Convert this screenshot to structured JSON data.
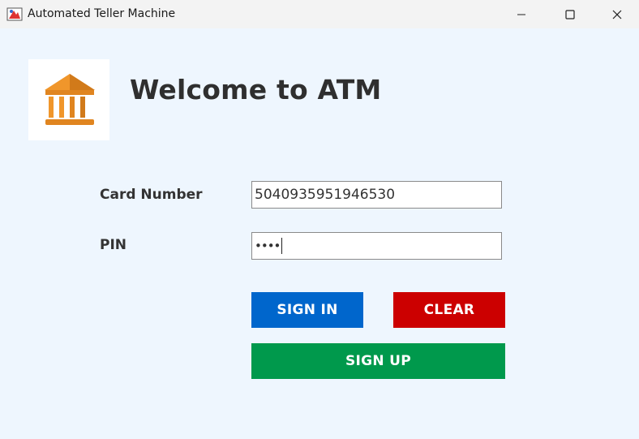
{
  "window": {
    "title": "Automated Teller Machine",
    "controls": [
      "minimize",
      "maximize",
      "close"
    ]
  },
  "header": {
    "logo_icon": "bank-icon",
    "welcome_text": "Welcome to ATM"
  },
  "form": {
    "card_label": "Card Number",
    "card_value": "5040935951946530",
    "pin_label": "PIN",
    "pin_masked": "••••"
  },
  "buttons": {
    "sign_in": "SIGN IN",
    "clear": "CLEAR",
    "sign_up": "SIGN UP"
  },
  "colors": {
    "background": "#eef6fe",
    "sign_in": "#0066cc",
    "clear": "#cc0000",
    "sign_up": "#00994c",
    "logo": "#e88f1e"
  }
}
